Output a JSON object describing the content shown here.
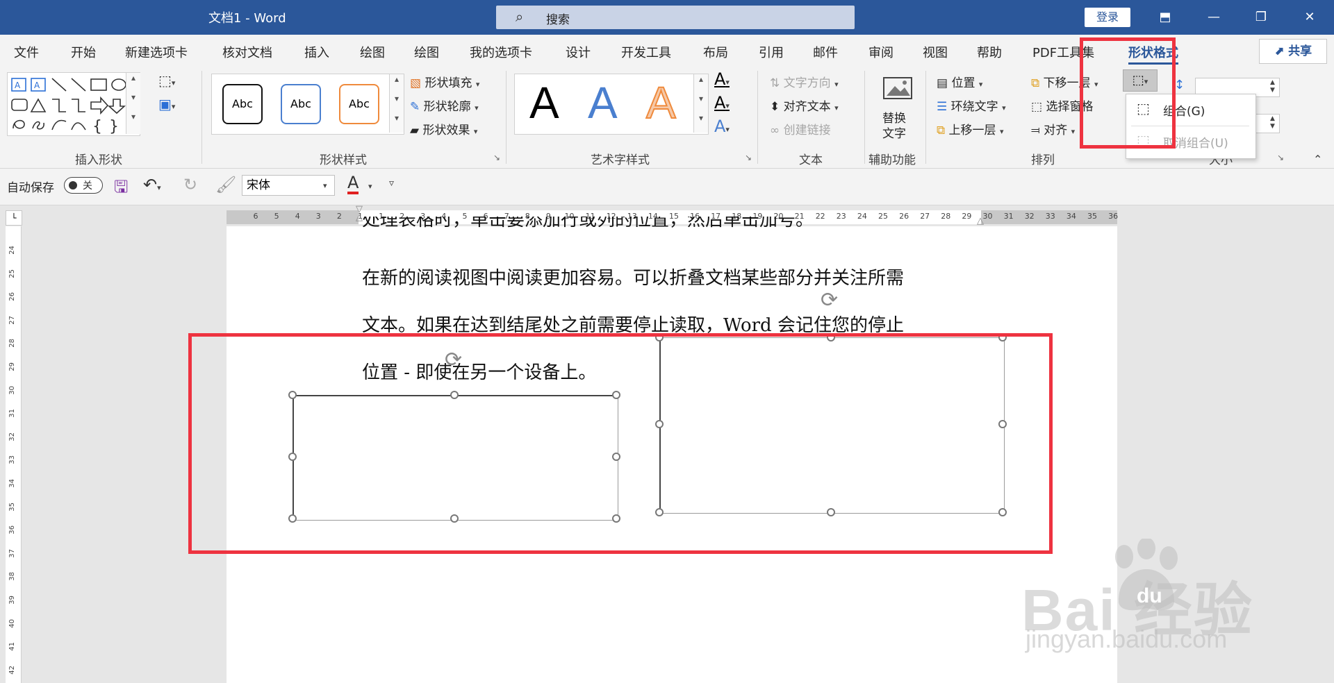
{
  "window": {
    "title": "文档1  -  Word",
    "search_placeholder": "搜索",
    "login_label": "登录",
    "share_label": "共享"
  },
  "tabs": [
    "文件",
    "开始",
    "新建选项卡",
    "核对文档",
    "插入",
    "绘图",
    "绘图",
    "我的选项卡",
    "设计",
    "开发工具",
    "布局",
    "引用",
    "邮件",
    "审阅",
    "视图",
    "帮助",
    "PDF工具集",
    "形状格式"
  ],
  "active_tab": "形状格式",
  "ribbon": {
    "groups": {
      "insert_shapes": "插入形状",
      "shape_styles": "形状样式",
      "wordart_styles": "艺术字样式",
      "text": "文本",
      "accessibility": "辅助功能",
      "arrange": "排列",
      "size": "大小"
    },
    "shape_style_samples": [
      "Abc",
      "Abc",
      "Abc"
    ],
    "shape_fill": "形状填充",
    "shape_outline": "形状轮廓",
    "shape_effects": "形状效果",
    "wordart_letter": "A",
    "text_direction": "文字方向",
    "align_text": "对齐文本",
    "create_link": "创建链接",
    "alt_text_line1": "替换",
    "alt_text_line2": "文字",
    "position": "位置",
    "wrap_text": "环绕文字",
    "bring_forward": "上移一层",
    "send_backward": "下移一层",
    "selection_pane": "选择窗格",
    "align": "对齐",
    "group_menu": {
      "group": "组合(G)",
      "ungroup": "取消组合(U)"
    }
  },
  "qat": {
    "autosave_label": "自动保存",
    "autosave_state": "关",
    "font_name": "宋体"
  },
  "ruler_numbers": [
    "6",
    "5",
    "4",
    "3",
    "2",
    "1",
    "1",
    "2",
    "3",
    "4",
    "5",
    "6",
    "7",
    "8",
    "9",
    "10",
    "11",
    "12",
    "13",
    "14",
    "15",
    "16",
    "17",
    "18",
    "19",
    "20",
    "21",
    "22",
    "23",
    "24",
    "25",
    "26",
    "27",
    "28",
    "29",
    "30",
    "31",
    "32",
    "33",
    "34",
    "35",
    "36"
  ],
  "vruler_numbers": [
    "24",
    "25",
    "26",
    "27",
    "28",
    "29",
    "30",
    "31",
    "32",
    "33",
    "34",
    "35",
    "36",
    "37",
    "38",
    "39",
    "40",
    "41",
    "42"
  ],
  "document": {
    "top_partial_line": "处理表格时，单击要添加行或列的位置，然后单击加号。",
    "paragraph_lines": [
      "在新的阅读视图中阅读更加容易。可以折叠文档某些部分并关注所需",
      "文本。如果在达到结尾处之前需要停止读取，Word 会记住您的停止",
      "位置 - 即使在另一个设备上。"
    ]
  },
  "watermark": {
    "brand": "Bai  经验",
    "url": "jingyan.baidu.com"
  },
  "colors": {
    "titlebar": "#2b579a",
    "accent": "#2b579a",
    "annotation": "#ee3340"
  }
}
